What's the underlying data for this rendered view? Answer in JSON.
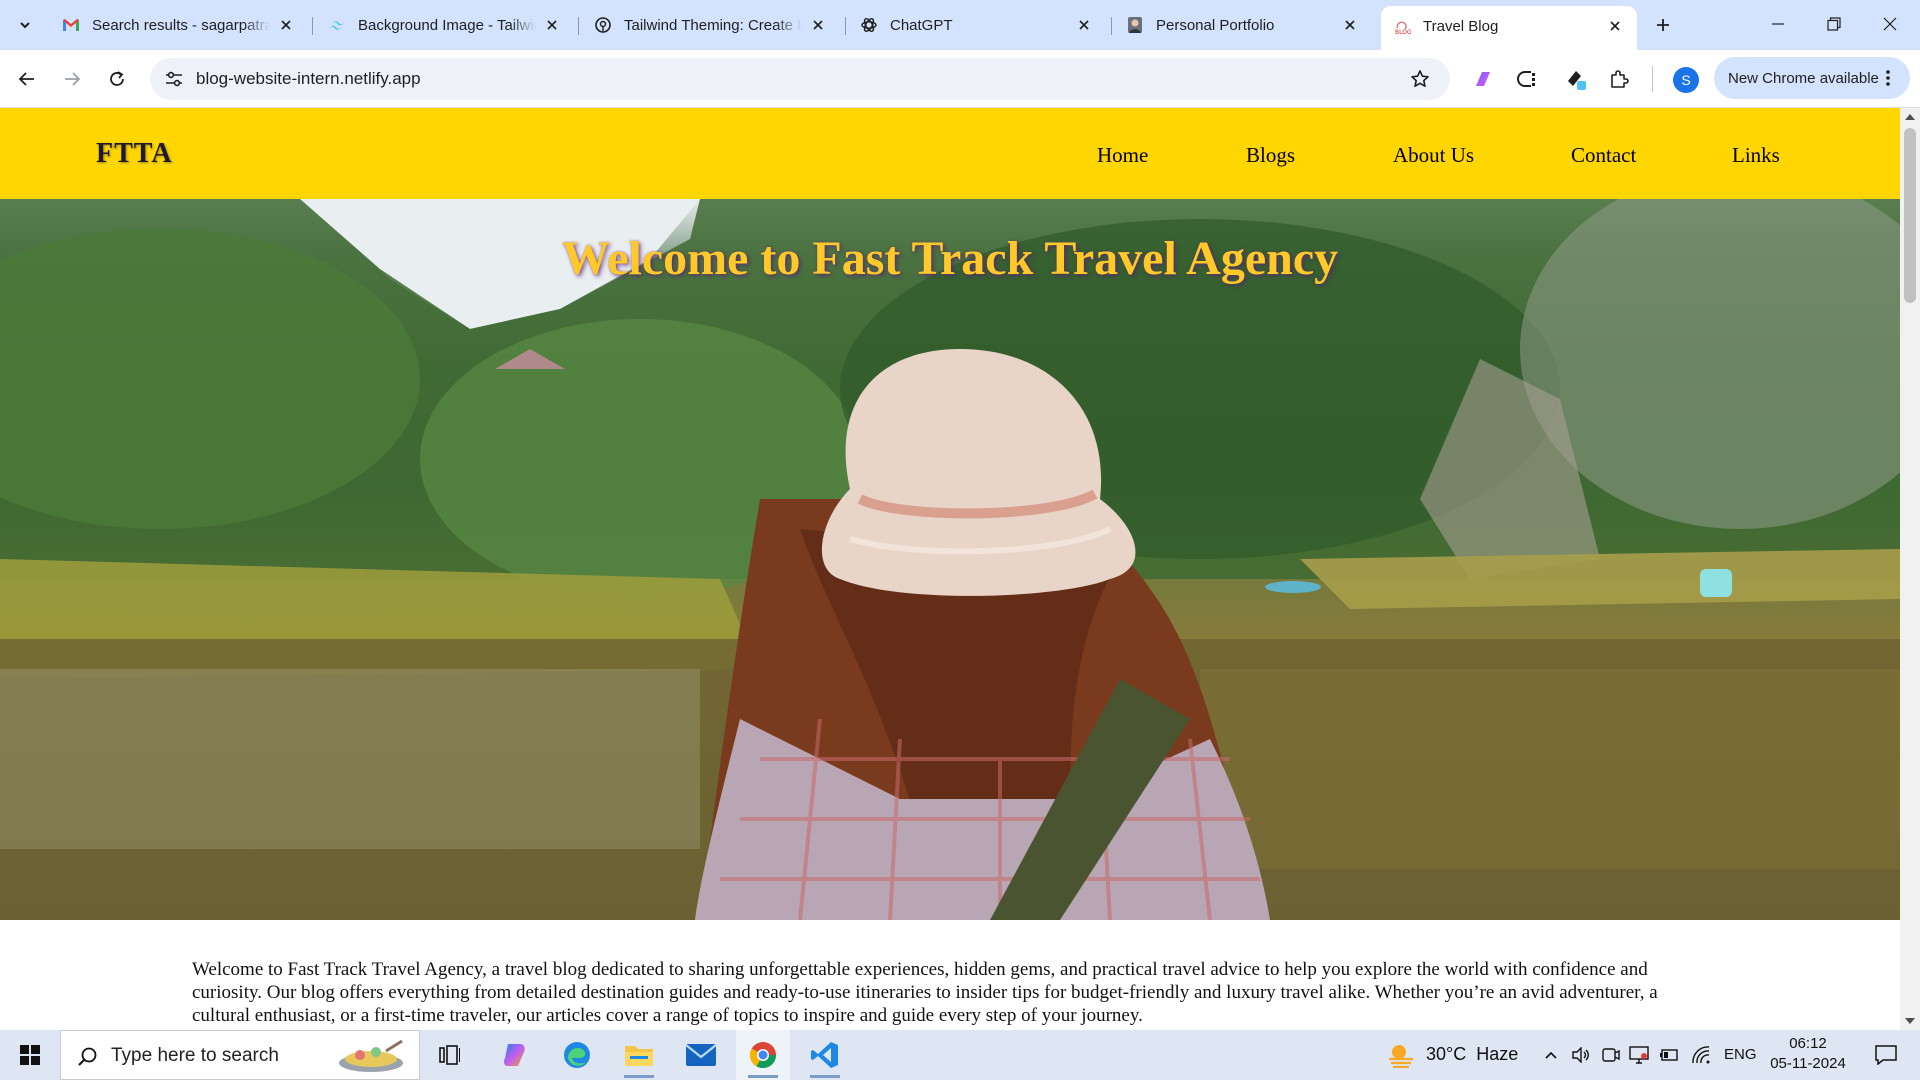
{
  "browser": {
    "tabs": [
      {
        "title": "Search results - sagarpatra",
        "icon": "gmail-icon",
        "active": false
      },
      {
        "title": "Background Image - Tailwind",
        "icon": "tailwind-icon",
        "active": false
      },
      {
        "title": "Tailwind Theming: Create L",
        "icon": "medium-icon",
        "active": false
      },
      {
        "title": "ChatGPT",
        "icon": "chatgpt-icon",
        "active": false
      },
      {
        "title": "Personal Portfolio",
        "icon": "portfolio-avatar-icon",
        "active": false
      },
      {
        "title": "Travel Blog",
        "icon": "blog-icon",
        "active": true
      }
    ],
    "url": "blog-website-intern.netlify.app",
    "profile_initial": "S",
    "update_label": "New Chrome available",
    "accent": "#d3e3fd"
  },
  "site": {
    "logo": "FTTA",
    "nav": [
      "Home",
      "Blogs",
      "About Us",
      "Contact",
      "Links"
    ],
    "hero_title": "Welcome to Fast Track Travel Agency",
    "intro": "Welcome to Fast Track Travel Agency, a travel blog dedicated to sharing unforgettable experiences, hidden gems, and practical travel advice to help you explore the world with confidence and curiosity. Our blog offers everything from detailed destination guides and ready-to-use itineraries to insider tips for budget-friendly and luxury travel alike. Whether you’re an avid adventurer, a cultural enthusiast, or a first-time traveler, our articles cover a range of topics to inspire and guide every step of your journey.",
    "nav_color": "#ffd600",
    "title_color": "#ffc928"
  },
  "taskbar": {
    "search_placeholder": "Type here to search",
    "weather": "30°C  Haze",
    "language": "ENG",
    "time": "06:12",
    "date": "05-11-2024"
  }
}
